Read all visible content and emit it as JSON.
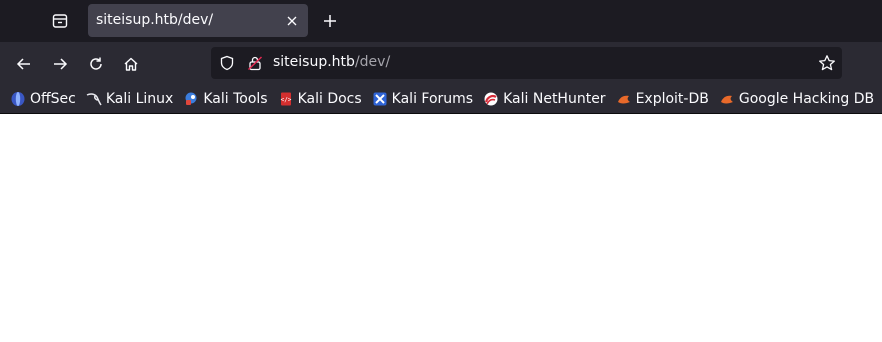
{
  "tab": {
    "title": "siteisup.htb/dev/"
  },
  "urlbar": {
    "host": "siteisup.htb",
    "path": "/dev/"
  },
  "bookmarks": [
    {
      "label": "OffSec",
      "icon": "offsec-icon"
    },
    {
      "label": "Kali Linux",
      "icon": "kali-dragon-icon"
    },
    {
      "label": "Kali Tools",
      "icon": "kali-tools-icon"
    },
    {
      "label": "Kali Docs",
      "icon": "kali-docs-icon"
    },
    {
      "label": "Kali Forums",
      "icon": "kali-forums-icon"
    },
    {
      "label": "Kali NetHunter",
      "icon": "nethunter-icon"
    },
    {
      "label": "Exploit-DB",
      "icon": "exploit-db-icon"
    },
    {
      "label": "Google Hacking DB",
      "icon": "ghdb-icon"
    }
  ],
  "colors": {
    "chrome_dark": "#1c1b22",
    "toolbar": "#2b2a33",
    "active_tab": "#42414d",
    "text": "#fbfbfe",
    "muted_text": "#a5a4ab"
  }
}
